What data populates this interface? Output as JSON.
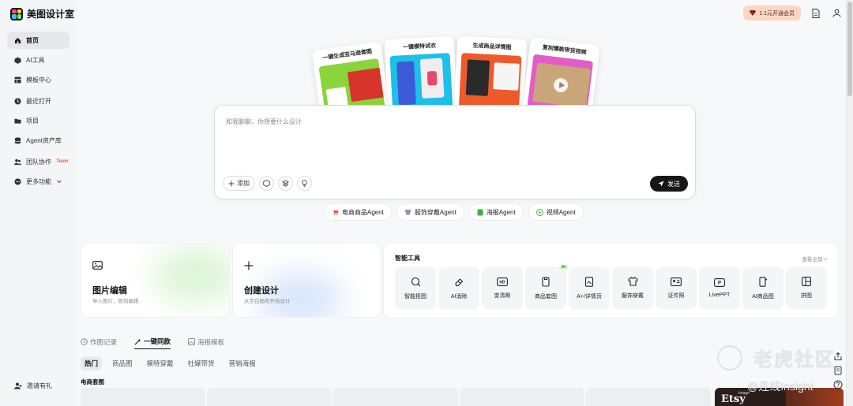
{
  "app": {
    "title": "美图设计室"
  },
  "sidebar": {
    "items": [
      {
        "label": "首页",
        "icon": "home-icon",
        "active": true
      },
      {
        "label": "AI工具",
        "icon": "cube-icon"
      },
      {
        "label": "模板中心",
        "icon": "grid-icon"
      },
      {
        "label": "最近打开",
        "icon": "clock-icon"
      },
      {
        "label": "项目",
        "icon": "folder-icon"
      },
      {
        "label": "Agent资产库",
        "icon": "database-icon"
      },
      {
        "label": "团队协作",
        "icon": "team-icon",
        "badge": "Team"
      },
      {
        "label": "更多功能",
        "icon": "more-icon"
      }
    ],
    "invite": "邀请有礼"
  },
  "topbar": {
    "vip_label": "1.1元开通会员"
  },
  "showcase": [
    {
      "title": "一键生成亚马逊套图"
    },
    {
      "title": "一键模特试衣"
    },
    {
      "title": "生成商品详情图"
    },
    {
      "title": "复刻爆款带货视频"
    }
  ],
  "chat": {
    "placeholder": "和我聊聊，你想要什么设计",
    "add_label": "添加",
    "send_label": "发送"
  },
  "agents": [
    {
      "label": "电商商品Agent",
      "icon": "cart-icon"
    },
    {
      "label": "服饰穿戴Agent",
      "icon": "shirt-icon"
    },
    {
      "label": "海报Agent",
      "icon": "poster-icon"
    },
    {
      "label": "视频Agent",
      "icon": "video-icon"
    }
  ],
  "image_edit": {
    "title": "图片编辑",
    "subtitle": "导入图片，即刻编辑"
  },
  "create_design": {
    "title": "创建设计",
    "subtitle": "从空白画布开始设计"
  },
  "smart_tools": {
    "title": "智能工具",
    "view_all": "查看全部 >",
    "items": [
      {
        "label": "智能抠图",
        "icon": "cutout-icon"
      },
      {
        "label": "AI消除",
        "icon": "eraser-icon"
      },
      {
        "label": "变清晰",
        "icon": "hd-icon"
      },
      {
        "label": "商品套图",
        "icon": "product-set-icon",
        "badge": "AI"
      },
      {
        "label": "A+/详情页",
        "icon": "detail-page-icon"
      },
      {
        "label": "服饰穿戴",
        "icon": "clothing-icon"
      },
      {
        "label": "证件照",
        "icon": "id-photo-icon"
      },
      {
        "label": "LivePPT",
        "icon": "ppt-icon"
      },
      {
        "label": "AI商品图",
        "icon": "ai-product-icon"
      },
      {
        "label": "拼图",
        "icon": "collage-icon"
      }
    ]
  },
  "content_tabs": [
    {
      "label": "作图记录",
      "active": false
    },
    {
      "label": "一键同款",
      "active": true
    },
    {
      "label": "海报模板",
      "active": false
    }
  ],
  "chips": [
    {
      "label": "热门",
      "active": true
    },
    {
      "label": "商品图"
    },
    {
      "label": "模特穿戴"
    },
    {
      "label": "社媒带货"
    },
    {
      "label": "营销海报"
    }
  ],
  "section": {
    "title": "电商套图"
  },
  "etsy_thumb": {
    "small": "Image",
    "title": "Etsy"
  },
  "watermark": {
    "line1": "老虎社区",
    "line2": "@连线Insight"
  }
}
